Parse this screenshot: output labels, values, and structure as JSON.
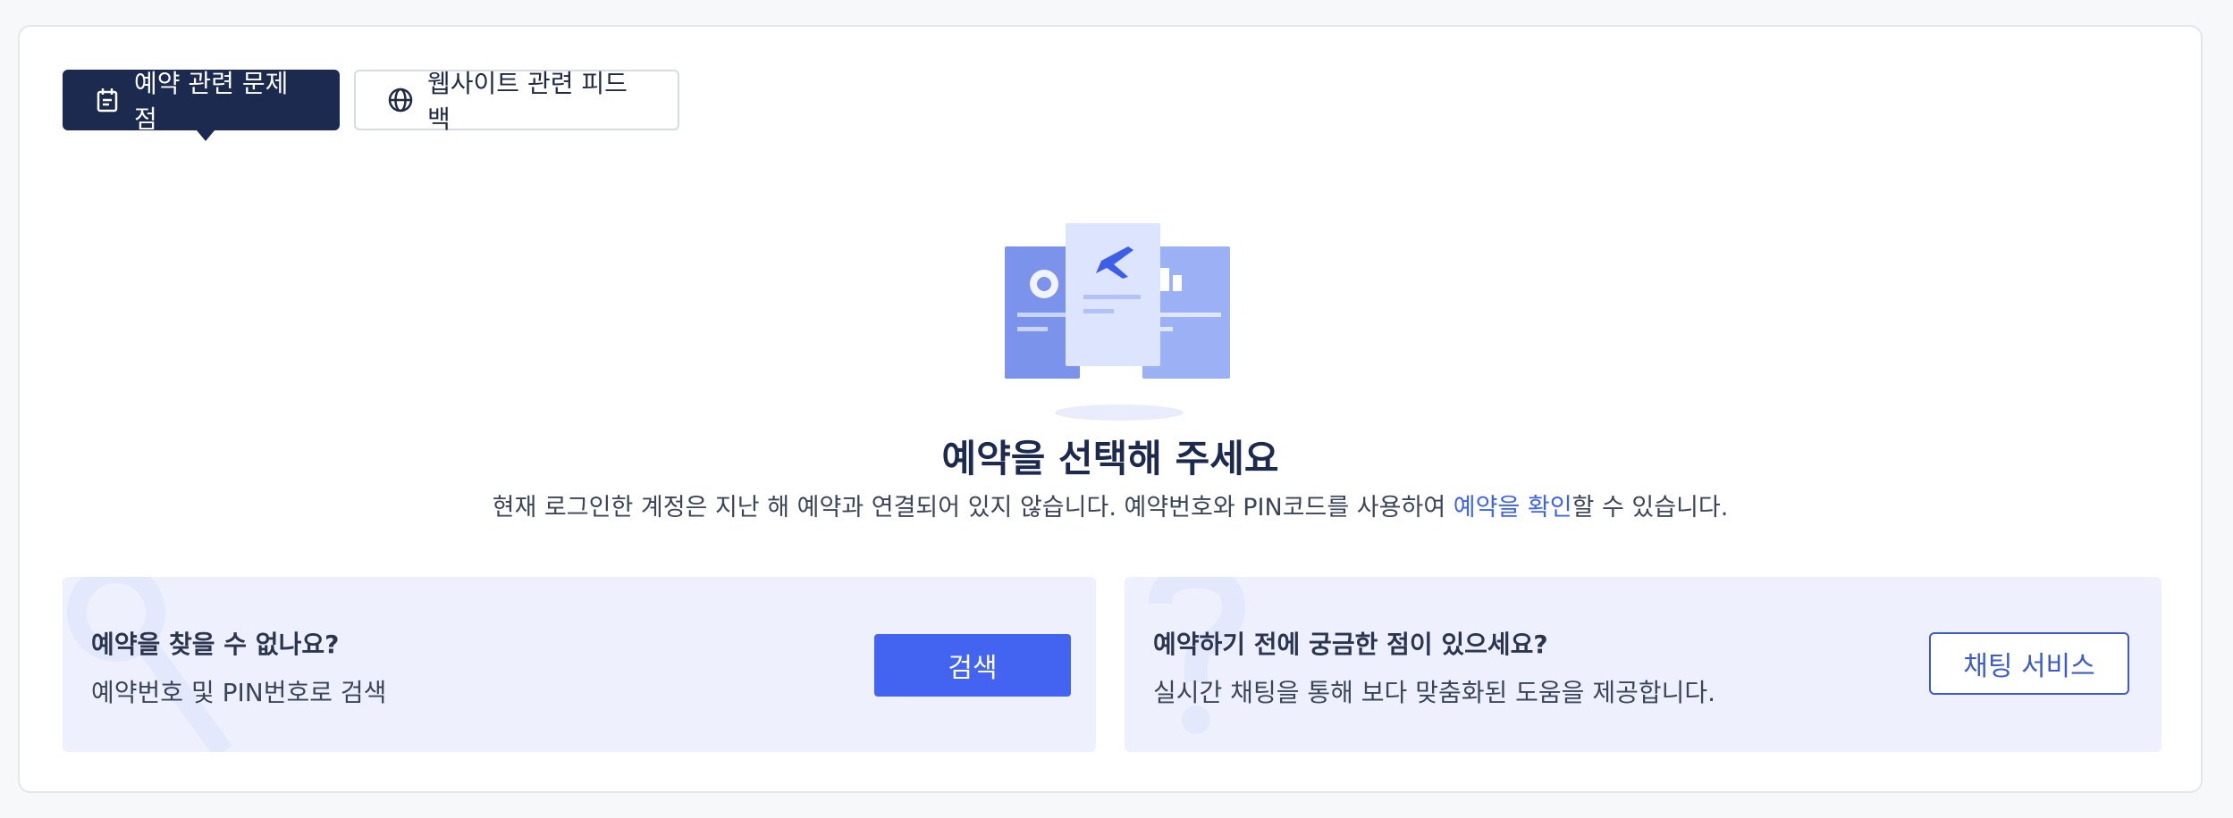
{
  "tabs": [
    {
      "label": "예약 관련 문제점",
      "icon": "calendar-icon",
      "active": true
    },
    {
      "label": "웹사이트 관련 피드백",
      "icon": "globe-icon",
      "active": false
    }
  ],
  "main": {
    "title": "예약을 선택해 주세요",
    "description_before": "현재 로그인한 계정은 지난 해 예약과 연결되어 있지 않습니다. 예약번호와 PIN코드를 사용하여 ",
    "description_link": "예약을 확인",
    "description_after": "할 수 있습니다."
  },
  "panels": {
    "search": {
      "heading": "예약을 찾을 수 없나요?",
      "text": "예약번호 및 PIN번호로 검색",
      "button": "검색"
    },
    "chat": {
      "heading": "예약하기 전에 궁금한 점이 있으세요?",
      "text": "실시간 채팅을 통해 보다 맞춤화된 도움을 제공합니다.",
      "button": "채팅 서비스"
    }
  },
  "colors": {
    "primary_dark": "#1b2a4e",
    "accent_blue": "#4264f0",
    "link_blue": "#3d63f0",
    "panel_bg": "#eef1fd"
  }
}
